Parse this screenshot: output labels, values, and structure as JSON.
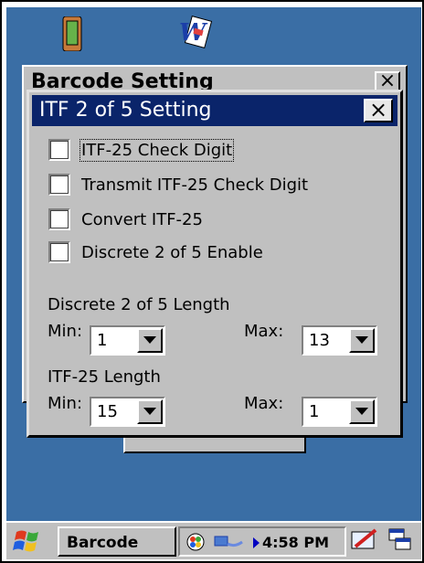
{
  "background_window": {
    "title": "Barcode Setting",
    "close_label": "×"
  },
  "dialog": {
    "title": "ITF 2 of 5 Setting",
    "close_label": "×",
    "checkboxes": [
      {
        "label": "ITF-25 Check Digit",
        "checked": false
      },
      {
        "label": "Transmit ITF-25 Check Digit",
        "checked": false
      },
      {
        "label": "Convert ITF-25",
        "checked": false
      },
      {
        "label": "Discrete 2 of 5 Enable",
        "checked": false
      }
    ],
    "discrete_length": {
      "label": "Discrete 2 of 5 Length",
      "min_label": "Min:",
      "min_value": "1",
      "max_label": "Max:",
      "max_value": "13"
    },
    "itf_length": {
      "label": "ITF-25 Length",
      "min_label": "Min:",
      "min_value": "15",
      "max_label": "Max:",
      "max_value": "1"
    }
  },
  "taskbar": {
    "task_label": "Barcode",
    "clock": "4:58 PM"
  },
  "icons": {
    "start": "windows-flag-icon",
    "desktop_app": "phone-icon",
    "desktop_doc": "word-document-icon",
    "tray_app": "network-icon",
    "sip": "pen-input-icon",
    "switcher": "window-switch-icon"
  },
  "colors": {
    "desktop": "#3a6ea5",
    "title_bar": "#0a246a",
    "chrome": "#c0c0c0"
  }
}
